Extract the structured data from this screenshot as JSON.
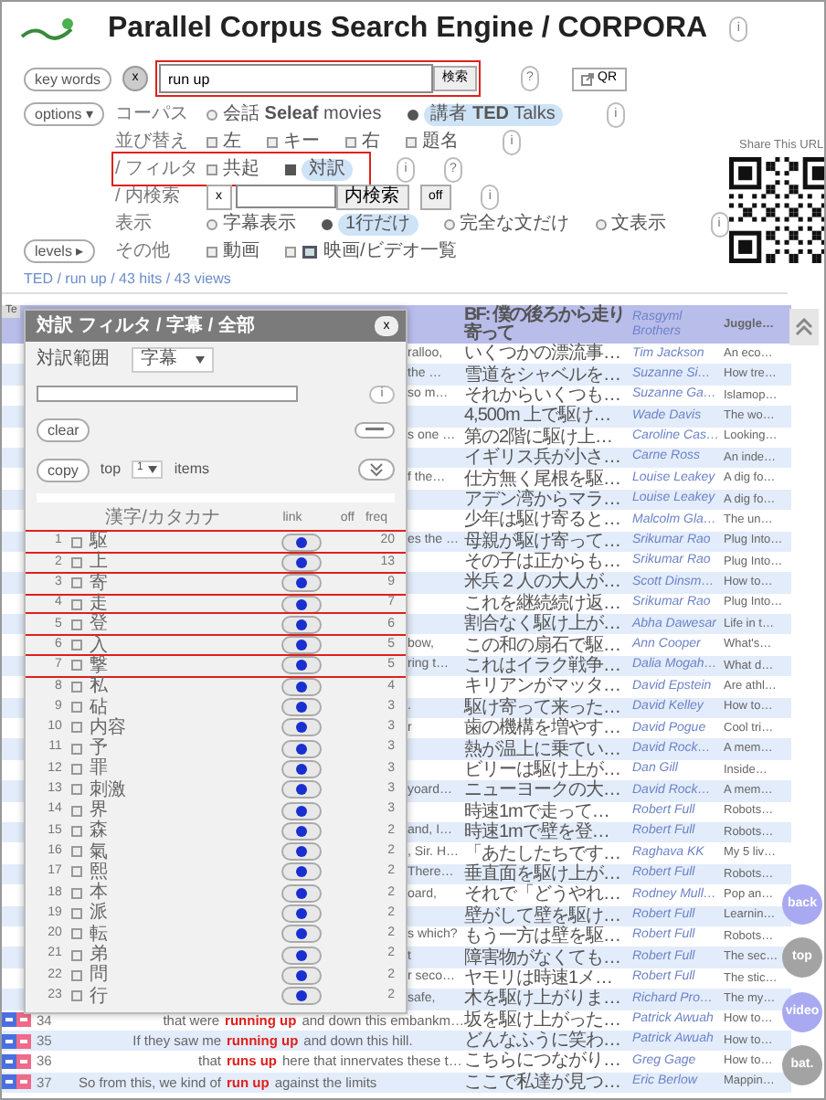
{
  "header": {
    "title": "Parallel Corpus Search Engine / CORPORA",
    "info": "i"
  },
  "search": {
    "side_button": "key words",
    "clear": "x",
    "value": "run up",
    "button": "検索",
    "highlighted": true,
    "buttons": [
      "?"
    ],
    "qr": "QR"
  },
  "option_rows": [
    {
      "side_button": "options ▾",
      "label": "コーパス",
      "kind": "radio",
      "choices": [
        {
          "label": "会話 **Seleaf** movies",
          "selected": false
        },
        {
          "label": "講者 **TED** Talks",
          "selected": true
        }
      ],
      "buttons": [
        "i"
      ]
    },
    {
      "label": "並び替え",
      "kind": "check",
      "choices": [
        {
          "label": "左",
          "checked": false
        },
        {
          "label": "キー",
          "checked": false
        },
        {
          "label": "右",
          "checked": false
        },
        {
          "label": "題名",
          "checked": false
        }
      ],
      "buttons": [
        "i"
      ]
    },
    {
      "label": "/ フィルタ",
      "kind": "check",
      "highlighted": true,
      "choices": [
        {
          "label": "共起",
          "checked": false
        },
        {
          "label": "対訳",
          "checked": true
        }
      ],
      "buttons": [
        "i",
        "?"
      ]
    },
    {
      "label": "/ 内検索",
      "kind": "search",
      "clear": "x",
      "button": "内検索",
      "toggle": "off",
      "buttons": [
        "i"
      ]
    },
    {
      "label": "表示",
      "kind": "radio",
      "choices": [
        {
          "label": "字幕表示",
          "selected": false
        },
        {
          "label": "1行だけ",
          "selected": true
        },
        {
          "label": "完全な文だけ",
          "selected": false
        },
        {
          "label": "文表示",
          "selected": false
        }
      ],
      "buttons": [
        "i"
      ]
    },
    {
      "side_button": "levels ▸",
      "label": "その他",
      "kind": "check",
      "choices": [
        {
          "label": "動画",
          "checked": false
        },
        {
          "label": "映画/ビデオ一覧",
          "checked": false,
          "icon": true
        }
      ]
    }
  ],
  "share": {
    "caption": "Share This URL"
  },
  "breadcrumb": "TED / run up / 43 hits / 43 views",
  "results": {
    "header": {
      "corner": "Te",
      "ja": "BF: 僕の後ろから走り寄って",
      "speaker": "Rasgyml Brothers",
      "title": "Juggle…"
    },
    "rows": [
      {
        "kind": "covered",
        "right": "ralloo,",
        "ja": "いくつかの漂流事…",
        "speaker": "Tim Jackson",
        "title": "An eco…"
      },
      {
        "kind": "covered",
        "right": "the …",
        "ja": "雪道をシャベルを…",
        "speaker": "Suzanne Si…",
        "title": "How tre…"
      },
      {
        "kind": "covered",
        "right": "so m…",
        "ja": "それからいくつも…",
        "speaker": "Suzanne Ga…",
        "title": "Islamop…"
      },
      {
        "kind": "covered",
        "ja": "4,500m 上で駆け…",
        "speaker": "Wade Davis",
        "title": "The wo…"
      },
      {
        "kind": "covered",
        "right": "s one …",
        "ja": "第の2階に駆け上…",
        "speaker": "Caroline Cas…",
        "title": "Looking…"
      },
      {
        "kind": "covered",
        "ja": "イギリス兵が小さ…",
        "speaker": "Carne Ross",
        "title": "An inde…"
      },
      {
        "kind": "covered",
        "right": "f the…",
        "ja": "仕方無く尾根を駆…",
        "speaker": "Louise Leakey",
        "title": "A dig fo…"
      },
      {
        "kind": "covered",
        "ja": "アデン湾からマラ…",
        "speaker": "Louise Leakey",
        "title": "A dig fo…"
      },
      {
        "kind": "covered",
        "ja": "少年は駆け寄ると…",
        "speaker": "Malcolm Gla…",
        "title": "The un…"
      },
      {
        "kind": "covered",
        "right": "es the …",
        "ja": "母親が駆け寄って…",
        "speaker": "Srikumar Rao",
        "title": "Plug Into…"
      },
      {
        "kind": "covered",
        "ja": "その子は正からも…",
        "speaker": "Srikumar Rao",
        "title": "Plug Into…"
      },
      {
        "kind": "covered",
        "ja": "米兵２人の大人が…",
        "speaker": "Scott Dinsm…",
        "title": "How to…"
      },
      {
        "kind": "covered",
        "ja": "これを継続続け返…",
        "speaker": "Srikumar Rao",
        "title": "Plug Into…"
      },
      {
        "kind": "covered",
        "ja": "割合なく駆け上が…",
        "speaker": "Abha Dawesar",
        "title": "Life in t…"
      },
      {
        "kind": "covered",
        "right": "bow,",
        "ja": "この和の扇石で駆…",
        "speaker": "Ann Cooper",
        "title": "What's…"
      },
      {
        "kind": "covered",
        "right": "ring t…",
        "ja": "これはイラク戦争…",
        "speaker": "Dalia Mogah…",
        "title": "What d…"
      },
      {
        "kind": "covered",
        "ja": "キリアンがマッタ…",
        "speaker": "David Epstein",
        "title": "Are athl…"
      },
      {
        "kind": "covered",
        "right": ".",
        "ja": "駆け寄って来った…",
        "speaker": "David Kelley",
        "title": "How to…"
      },
      {
        "kind": "covered",
        "right": "r",
        "ja": "歯の機構を増やす…",
        "speaker": "David Pogue",
        "title": "Cool tri…"
      },
      {
        "kind": "covered",
        "ja": "熱が温上に乗てい…",
        "speaker": "David Rock…",
        "title": "A mem…"
      },
      {
        "kind": "covered",
        "ja": "ビリーは駆け上が…",
        "speaker": "Dan Gill",
        "title": "Inside…"
      },
      {
        "kind": "covered",
        "right": "yoard…",
        "ja": "ニューヨークの大…",
        "speaker": "David Rock…",
        "title": "A mem…"
      },
      {
        "kind": "covered",
        "ja": "時速1mで走って…",
        "speaker": "Robert Full",
        "title": "Robots…"
      },
      {
        "kind": "covered",
        "right": "and, I…",
        "ja": "時速1mで壁を登…",
        "speaker": "Robert Full",
        "title": "Robots…"
      },
      {
        "kind": "covered",
        "right": ", Sir. H…",
        "ja": "「あたしたちです…",
        "speaker": "Raghava KK",
        "title": "My 5 liv…"
      },
      {
        "kind": "covered",
        "right": "There…",
        "ja": "垂直面を駆け上が…",
        "speaker": "Robert Full",
        "title": "Robots…"
      },
      {
        "kind": "covered",
        "right": "oard,",
        "ja": "それで「どうやれ…",
        "speaker": "Rodney Mull…",
        "title": "Pop an…"
      },
      {
        "kind": "covered",
        "ja": "壁がして壁を駆け…",
        "speaker": "Robert Full",
        "title": "Learnin…"
      },
      {
        "kind": "covered",
        "right": "s which?",
        "ja": "もう一方は壁を駆…",
        "speaker": "Robert Full",
        "title": "Robots…"
      },
      {
        "kind": "covered",
        "right": "t",
        "ja": "障害物がなくても…",
        "speaker": "Robert Full",
        "title": "The sec…"
      },
      {
        "kind": "covered",
        "right": "r seco…",
        "ja": "ヤモリは時速1メ…",
        "speaker": "Robert Full",
        "title": "The stic…"
      },
      {
        "kind": "covered",
        "right": "safe,",
        "ja": "木を駆け上がりま…",
        "speaker": "Richard Pro…",
        "title": "The my…"
      },
      {
        "kind": "full",
        "number": "34",
        "left": "that were",
        "match": "running up",
        "right": "and down this embankm…",
        "ja": "坂を駆け上がった…",
        "speaker": "Patrick Awuah",
        "title": "How to…"
      },
      {
        "kind": "full",
        "number": "35",
        "left": "If they saw me",
        "match": "running up",
        "right": "and down this hill.",
        "ja": "どんなふうに笑わ…",
        "speaker": "Patrick Awuah",
        "title": "How to…"
      },
      {
        "kind": "full",
        "number": "36",
        "left": "that",
        "match": "runs up",
        "right": "here that innervates these t…",
        "ja": "こちらにつながり…",
        "speaker": "Greg Gage",
        "title": "How to…"
      },
      {
        "kind": "full",
        "number": "37",
        "left": "So from this, we kind of",
        "match": "run up",
        "right": "against the limits",
        "ja": "ここで私達が見つ…",
        "speaker": "Eric Berlow",
        "title": "Mappin…"
      }
    ]
  },
  "float_buttons": [
    {
      "label": "back",
      "color": "#a9a9f2"
    },
    {
      "label": "top",
      "color": "#a3a3a3"
    },
    {
      "label": "video",
      "color": "#a9a9f2"
    },
    {
      "label": "bat.",
      "color": "#a3a3a3"
    }
  ],
  "filter_panel": {
    "title": "対訳 フィルタ / 字幕 / 全部",
    "close": "x",
    "range_label": "対訳範囲",
    "range_value": "字幕",
    "input_button": "i",
    "clear": "clear",
    "copy": "copy",
    "top_label": "top",
    "top_value": "1",
    "items_label": "items",
    "columns": [
      "漢字/カタカナ",
      "link",
      "off",
      "freq"
    ],
    "rows": [
      {
        "number": "1",
        "term": "駆",
        "freq": "20",
        "checked": false,
        "link": true,
        "highlighted": true
      },
      {
        "number": "2",
        "term": "上",
        "freq": "13",
        "checked": false,
        "link": true,
        "highlighted": false
      },
      {
        "number": "3",
        "term": "寄",
        "freq": "9",
        "checked": false,
        "link": true,
        "highlighted": true
      },
      {
        "number": "4",
        "term": "走",
        "freq": "7",
        "checked": false,
        "link": true,
        "highlighted": false
      },
      {
        "number": "5",
        "term": "登",
        "freq": "6",
        "checked": false,
        "link": true,
        "highlighted": true
      },
      {
        "number": "6",
        "term": "入",
        "freq": "5",
        "checked": false,
        "link": true,
        "highlighted": false
      },
      {
        "number": "7",
        "term": "撃",
        "freq": "5",
        "checked": false,
        "link": true,
        "highlighted": true
      },
      {
        "number": "8",
        "term": "私",
        "freq": "4",
        "checked": false,
        "link": true,
        "highlighted": false
      },
      {
        "number": "9",
        "term": "砧",
        "freq": "3",
        "checked": false,
        "link": true,
        "highlighted": false
      },
      {
        "number": "10",
        "term": "内容",
        "freq": "3",
        "checked": false,
        "link": true,
        "highlighted": false
      },
      {
        "number": "11",
        "term": "予",
        "freq": "3",
        "checked": false,
        "link": true,
        "highlighted": false
      },
      {
        "number": "12",
        "term": "罪",
        "freq": "3",
        "checked": false,
        "link": true,
        "highlighted": false
      },
      {
        "number": "13",
        "term": "刺激",
        "freq": "3",
        "checked": false,
        "link": true,
        "highlighted": false
      },
      {
        "number": "14",
        "term": "界",
        "freq": "3",
        "checked": false,
        "link": true,
        "highlighted": false
      },
      {
        "number": "15",
        "term": "森",
        "freq": "2",
        "checked": false,
        "link": true,
        "highlighted": false
      },
      {
        "number": "16",
        "term": "氣",
        "freq": "2",
        "checked": false,
        "link": true,
        "highlighted": false
      },
      {
        "number": "17",
        "term": "熙",
        "freq": "2",
        "checked": false,
        "link": true,
        "highlighted": false
      },
      {
        "number": "18",
        "term": "本",
        "freq": "2",
        "checked": false,
        "link": true,
        "highlighted": false
      },
      {
        "number": "19",
        "term": "派",
        "freq": "2",
        "checked": false,
        "link": true,
        "highlighted": false
      },
      {
        "number": "20",
        "term": "転",
        "freq": "2",
        "checked": false,
        "link": true,
        "highlighted": false
      },
      {
        "number": "21",
        "term": "弟",
        "freq": "2",
        "checked": false,
        "link": true,
        "highlighted": false
      },
      {
        "number": "22",
        "term": "問",
        "freq": "2",
        "checked": false,
        "link": true,
        "highlighted": false
      },
      {
        "number": "23",
        "term": "行",
        "freq": "2",
        "checked": false,
        "link": true,
        "highlighted": false
      }
    ]
  }
}
